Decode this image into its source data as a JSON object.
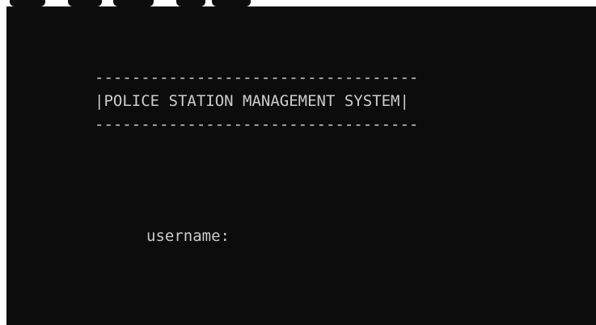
{
  "console": {
    "dash_rule": "-----------------------------------",
    "title": "POLICE STATION MANAGEMENT SYSTEM",
    "border_char": "|",
    "prompt_label": "username:",
    "input_value": ""
  },
  "colors": {
    "background": "#0c0c0c",
    "text": "#cccccc",
    "frame": "#ffffff"
  }
}
